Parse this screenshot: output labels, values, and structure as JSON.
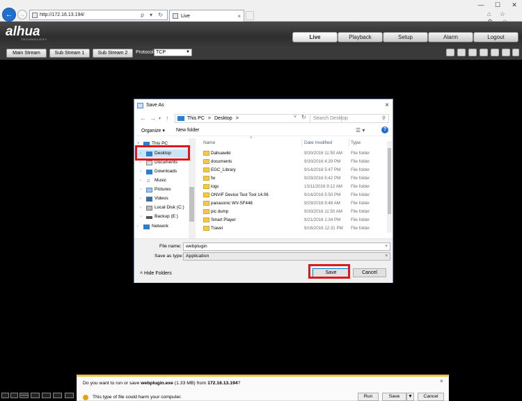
{
  "browser": {
    "url": "http://172.16.13.194/",
    "tab_title": "Live",
    "address_icons": "ρ ▾ ↻",
    "window_controls": [
      "—",
      "☐",
      "✕"
    ],
    "toolbar_icons": "⌂ ☆ ⚙ ☺"
  },
  "app": {
    "logo": "alhua",
    "logo_sub": "TECHNOLOGY",
    "nav_tabs": [
      "Live",
      "Playback",
      "Setup",
      "Alarm",
      "Logout"
    ],
    "active_tab": "Live",
    "stream_buttons": [
      "Main Stream",
      "Sub Stream 1",
      "Sub Stream 2"
    ],
    "protocol_label": "Protocol",
    "protocol_value": "TCP"
  },
  "dialog": {
    "title": "Save As",
    "breadcrumb": [
      "This PC",
      ">",
      "Desktop",
      ">"
    ],
    "search_placeholder": "Search Desktop",
    "organize": "Organize ▾",
    "new_folder": "New folder",
    "help": "?",
    "tree": [
      {
        "label": "This PC"
      },
      {
        "label": "Desktop",
        "selected": true
      },
      {
        "label": "Documents"
      },
      {
        "label": "Downloads"
      },
      {
        "label": "Music"
      },
      {
        "label": "Pictures"
      },
      {
        "label": "Videos"
      },
      {
        "label": "Local Disk (C:)"
      },
      {
        "label": "Backup (E:)"
      },
      {
        "label": "Network"
      }
    ],
    "columns": {
      "name": "Name",
      "date": "Date modified",
      "type": "Type"
    },
    "files": [
      {
        "name": "Dahuawiki",
        "date": "9/30/2016 11:50 AM",
        "type": "File folder"
      },
      {
        "name": "documents",
        "date": "9/30/2016 4:29 PM",
        "type": "File folder"
      },
      {
        "name": "EGC_Library",
        "date": "9/14/2016 5:47 PM",
        "type": "File folder"
      },
      {
        "name": "fw",
        "date": "9/29/2016 5:42 PM",
        "type": "File folder"
      },
      {
        "name": "logs",
        "date": "10/11/2016 9:12 AM",
        "type": "File folder"
      },
      {
        "name": "ONVIF Device Test Tool 14.06",
        "date": "9/14/2016 5:50 PM",
        "type": "File folder"
      },
      {
        "name": "panasonic WV-SF448",
        "date": "9/29/2016 9:48 AM",
        "type": "File folder"
      },
      {
        "name": "pic dump",
        "date": "9/30/2016 11:50 AM",
        "type": "File folder"
      },
      {
        "name": "Smart Player",
        "date": "9/21/2016 1:34 PM",
        "type": "File folder"
      },
      {
        "name": "Travel",
        "date": "9/16/2016 12:31 PM",
        "type": "File folder"
      }
    ],
    "file_name_label": "File name:",
    "file_name_value": "webplugin",
    "save_type_label": "Save as type:",
    "save_type_value": "Application",
    "hide_folders": "Hide Folders",
    "save_button": "Save",
    "cancel_button": "Cancel"
  },
  "download_bar": {
    "prefix": "Do you want to run or save ",
    "file": "webplugin.exe",
    "middle": " (1.33 MB) from ",
    "host": "172.16.13.194",
    "suffix": "?",
    "warning": "This type of file could harm your computer.",
    "run": "Run",
    "save": "Save",
    "cancel": "Cancel"
  },
  "colors": {
    "highlight": "#e0161b",
    "accent": "#1f6fd0",
    "folder": "#f2c94c"
  }
}
